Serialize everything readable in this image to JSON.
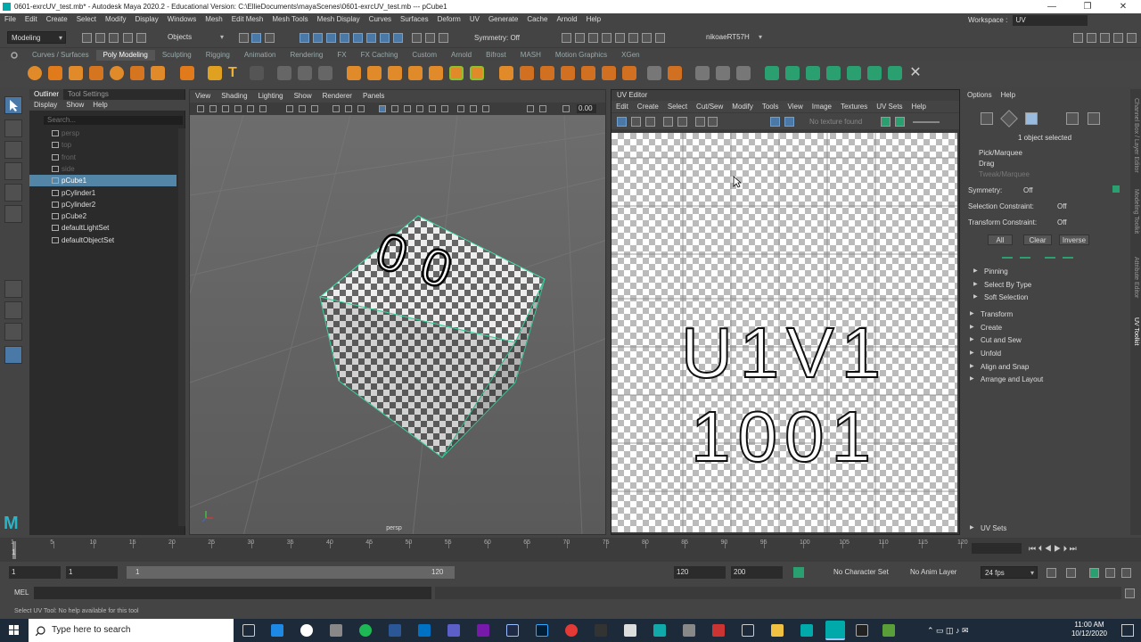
{
  "titlebar": {
    "title": "0601-exrcUV_test.mb* - Autodesk Maya 2020.2 - Educational Version: C:\\EllieDocuments\\mayaScenes\\0601-exrcUV_test.mb  ---  pCube1",
    "minimize": "—",
    "maximize": "❐",
    "close": "✕"
  },
  "menubar": [
    "File",
    "Edit",
    "Create",
    "Select",
    "Modify",
    "Display",
    "Windows",
    "Mesh",
    "Edit Mesh",
    "Mesh Tools",
    "Mesh Display",
    "Curves",
    "Surfaces",
    "Deform",
    "UV",
    "Generate",
    "Cache",
    "Arnold",
    "Help"
  ],
  "workspace": {
    "label": "Workspace :",
    "value": "UV"
  },
  "statusline": {
    "mode": "Modeling",
    "selection_mode": "Objects",
    "symmetry": "Symmetry: Off",
    "user": "nikoaeRT57H"
  },
  "shelf_tabs": [
    "Curves / Surfaces",
    "Poly Modeling",
    "Sculpting",
    "Rigging",
    "Animation",
    "Rendering",
    "FX",
    "FX Caching",
    "Custom",
    "Arnold",
    "Bifrost",
    "MASH",
    "Motion Graphics",
    "XGen"
  ],
  "shelf_tabs_active": "Poly Modeling",
  "outliner": {
    "tabs": [
      "Outliner",
      "Tool Settings"
    ],
    "menu": [
      "Display",
      "Show",
      "Help"
    ],
    "search_placeholder": "Search...",
    "items": [
      {
        "label": "persp",
        "dim": true,
        "selected": false
      },
      {
        "label": "top",
        "dim": true,
        "selected": false
      },
      {
        "label": "front",
        "dim": true,
        "selected": false
      },
      {
        "label": "side",
        "dim": true,
        "selected": false
      },
      {
        "label": "pCube1",
        "dim": false,
        "selected": true
      },
      {
        "label": "pCylinder1",
        "dim": false,
        "selected": false
      },
      {
        "label": "pCylinder2",
        "dim": false,
        "selected": false
      },
      {
        "label": "pCube2",
        "dim": false,
        "selected": false
      },
      {
        "label": "defaultLightSet",
        "dim": false,
        "selected": false
      },
      {
        "label": "defaultObjectSet",
        "dim": false,
        "selected": false
      }
    ]
  },
  "viewport": {
    "menu": [
      "View",
      "Shading",
      "Lighting",
      "Show",
      "Renderer",
      "Panels"
    ],
    "camera_label": "persp",
    "value_field": "0.00",
    "cube_text": "00"
  },
  "uv_editor": {
    "title": "UV Editor",
    "menu": [
      "Edit",
      "Create",
      "Select",
      "Cut/Sew",
      "Modify",
      "Tools",
      "View",
      "Image",
      "Textures",
      "UV Sets",
      "Help"
    ],
    "texture_status": "No texture found",
    "tile_line1": "U1V1",
    "tile_line2": "1001"
  },
  "uv_toolkit": {
    "menu": [
      "Options",
      "Help"
    ],
    "selection_status": "1 object selected",
    "modes": [
      "Pick/Marquee",
      "Drag",
      "Tweak/Marquee"
    ],
    "symmetry_label": "Symmetry:",
    "symmetry_value": "Off",
    "selection_constraint_label": "Selection Constraint:",
    "selection_constraint_value": "Off",
    "transform_constraint_label": "Transform Constraint:",
    "transform_constraint_value": "Off",
    "buttons": [
      "All",
      "Clear",
      "Inverse"
    ],
    "subsections": [
      "Pinning",
      "Select By Type",
      "Soft Selection"
    ],
    "sections": [
      "Transform",
      "Create",
      "Cut and Sew",
      "Unfold",
      "Align and Snap",
      "Arrange and Layout"
    ],
    "uv_sets": "UV Sets"
  },
  "side_tabs": [
    "Channel Box / Layer Editor",
    "Modeling Toolkit",
    "Attribute Editor",
    "UV Toolkit"
  ],
  "timeline": {
    "ticks": [
      "1",
      "5",
      "10",
      "15",
      "20",
      "25",
      "30",
      "35",
      "40",
      "45",
      "50",
      "55",
      "60",
      "65",
      "70",
      "75",
      "80",
      "85",
      "90",
      "95",
      "100",
      "105",
      "110",
      "115",
      "120"
    ],
    "current_frame": "1"
  },
  "range": {
    "start": "1",
    "start_inner": "1",
    "slider_start": "1",
    "slider_end": "120",
    "end_inner": "120",
    "end": "200",
    "character_set": "No Character Set",
    "anim_layer": "No Anim Layer",
    "fps": "24 fps"
  },
  "mel_label": "MEL",
  "help_line": "Select UV Tool: No help available for this tool",
  "taskbar": {
    "search_placeholder": "Type here to search",
    "time": "11:00 AM",
    "date": "10/12/2020"
  },
  "colors": {
    "selection": "#5285a6",
    "maya_bg": "#444444",
    "taskbar": "#1c2a3a"
  }
}
